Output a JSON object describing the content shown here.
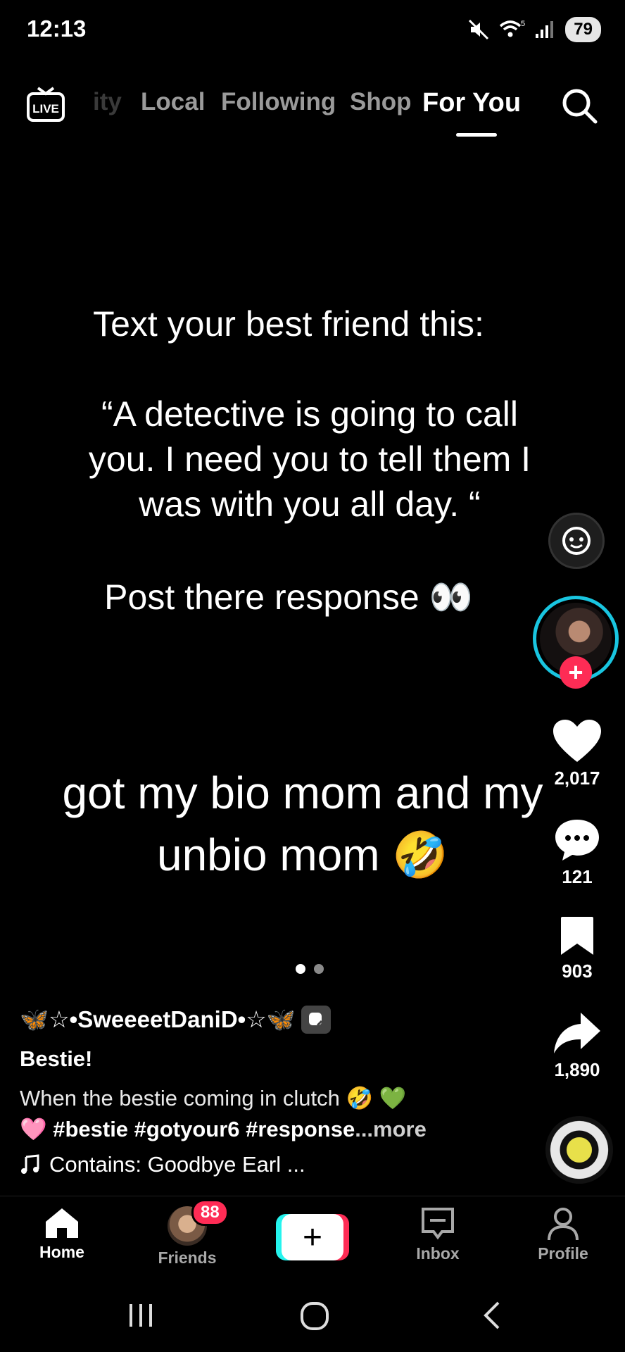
{
  "status_bar": {
    "time": "12:13",
    "battery": "79",
    "wifi_level": "5"
  },
  "top_nav": {
    "tabs": [
      {
        "label": "ity",
        "state": "faded"
      },
      {
        "label": "Local",
        "state": "inactive"
      },
      {
        "label": "Following",
        "state": "inactive"
      },
      {
        "label": "Shop",
        "state": "inactive"
      },
      {
        "label": "For You",
        "state": "active"
      }
    ],
    "live_label": "LIVE"
  },
  "video": {
    "overlay_lines": [
      "Text your best friend this:",
      "“A detective is going to call you. I need you to tell them I was with you all day. “",
      "Post there response 👀"
    ],
    "caption": "got my bio mom and my unbio mom 🤣"
  },
  "actions": {
    "likes": "2,017",
    "comments": "121",
    "saves": "903",
    "shares": "1,890",
    "follow_label": "+"
  },
  "post": {
    "username": "🦋☆•SweeeetDaniD•☆🦋",
    "title": "Bestie!",
    "description": "When the bestie coming in clutch 🤣 💚",
    "hashtags": "🩷 #bestie #gotyour6 #response",
    "more_label": "...more",
    "music": "Contains: Goodbye Earl ..."
  },
  "tabbar": {
    "home": "Home",
    "friends": "Friends",
    "friends_badge": "88",
    "create": "+",
    "inbox": "Inbox",
    "profile": "Profile"
  },
  "colors": {
    "accent_red": "#fe2c55",
    "accent_cyan": "#25f4ee",
    "ring": "#19c5e0"
  }
}
